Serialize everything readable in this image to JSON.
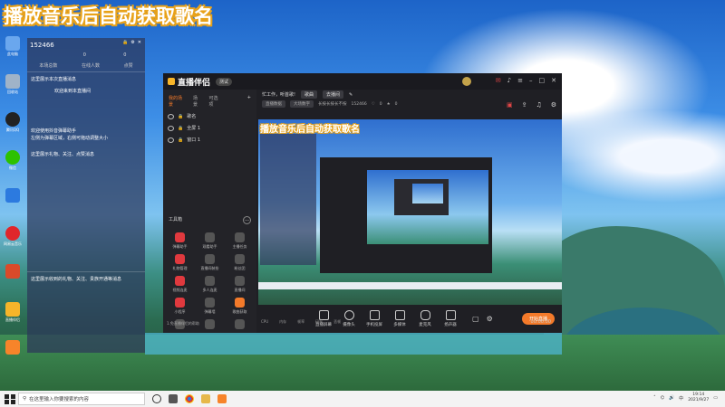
{
  "overlay_title": "播放音乐后自动获取歌名",
  "desktop_icons": [
    {
      "label": "此电脑",
      "color": "#6aa7ee"
    },
    {
      "label": "回收站",
      "color": "#9fb3c8"
    },
    {
      "label": "腾讯QQ",
      "color": "#222"
    },
    {
      "label": "微信",
      "color": "#2dc100"
    },
    {
      "label": "",
      "color": "#2c7adf"
    },
    {
      "label": "网易云音乐",
      "color": "#e0262b"
    },
    {
      "label": "",
      "color": "#d94a2a"
    },
    {
      "label": "直播伴侣",
      "color": "#f7b52a"
    },
    {
      "label": "",
      "color": "#f7842a"
    }
  ],
  "chat_panel": {
    "room_id": "152466",
    "stats": [
      "",
      "0",
      "0"
    ],
    "stat_labels": [
      "本场总数",
      "在线人数",
      "点赞"
    ],
    "messages": [
      "这里展示本次直播消息",
      "欢迎来到本直播间",
      "欢迎使用抖音弹幕助手",
      "左侧为弹幕区域，右侧可拖动调整大小",
      "这里展示礼物、关注、点赞消息",
      "这里展示收到的礼物、关注、贵族开通等消息"
    ]
  },
  "app": {
    "name": "直播伴侣",
    "version": "测试",
    "tabs": [
      "我的场景",
      "场景",
      "可选项"
    ],
    "scenes": [
      "歌名",
      "全屏 1",
      "窗口 1"
    ],
    "tools_heading": "工具箱",
    "tools": [
      {
        "label": "弹幕助手",
        "color": "#e0393e"
      },
      {
        "label": "观看助手",
        "color": "#555"
      },
      {
        "label": "主播任务",
        "color": "#555"
      },
      {
        "label": "礼物管理",
        "color": "#e0393e"
      },
      {
        "label": "直播间装扮",
        "color": "#555"
      },
      {
        "label": "粉丝团",
        "color": "#555"
      },
      {
        "label": "视频连麦",
        "color": "#e0393e"
      },
      {
        "label": "多人连麦",
        "color": "#555"
      },
      {
        "label": "直播间",
        "color": "#555"
      },
      {
        "label": "小程序",
        "color": "#e0393e"
      },
      {
        "label": "弹幕墙",
        "color": "#555"
      },
      {
        "label": "歌曲获取",
        "color": "#f47a2a"
      },
      {
        "label": "",
        "color": "#555"
      },
      {
        "label": "",
        "color": "#555"
      },
      {
        "label": "",
        "color": "#555"
      }
    ],
    "tip": "1.免直播伴侣的帮助",
    "room_title": "忙工作，听首歌!",
    "room_tag": "歌曲",
    "room_btn": "去播间",
    "room_row2": [
      "直播数据",
      "大场数字",
      "长按长按长不按",
      "152466",
      "0",
      "0"
    ],
    "controls": [
      "直播屏幕",
      "摄像头",
      "手机投屏",
      "多媒体",
      "麦克风",
      "扬声器"
    ],
    "start_button": "开始直播",
    "status_left": [
      "CPU",
      "内存",
      "帧率",
      "码率",
      "丢帧"
    ],
    "status_right": "00:00:00"
  },
  "taskbar": {
    "search_placeholder": "在这里输入你要搜索的内容",
    "time": "19:14",
    "date": "2021/9/27"
  }
}
